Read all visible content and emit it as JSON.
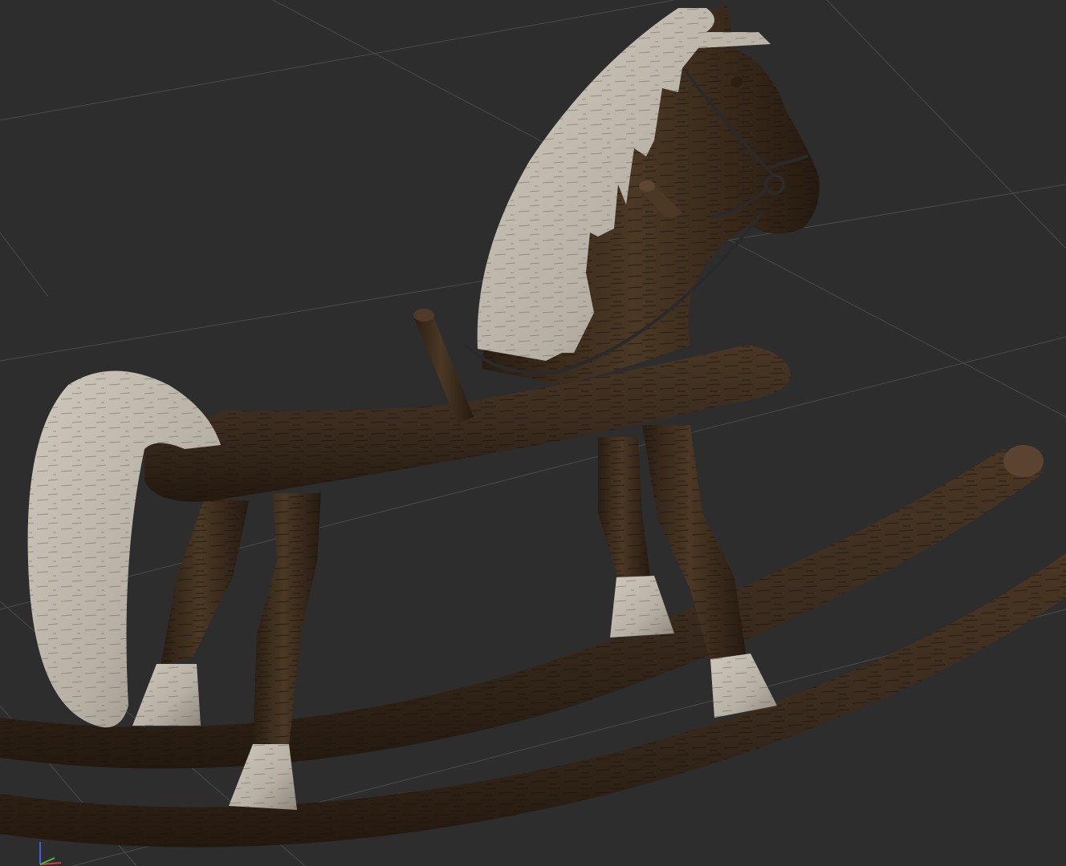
{
  "viewport": {
    "background": "#2d2d2d",
    "grid_color": "#4a4a4a"
  },
  "model": {
    "subject": "rocking-horse",
    "dark_wood": "#3b2c1f",
    "dark_wood_shadow": "#24190f",
    "light_wood": "#bdb6ab",
    "light_wood_shadow": "#8e877c",
    "bridle_metal": "#2a2a2a"
  },
  "gizmo": {
    "x_axis_color": "#d04040",
    "y_axis_color": "#40c040",
    "z_axis_color": "#4060e0"
  }
}
